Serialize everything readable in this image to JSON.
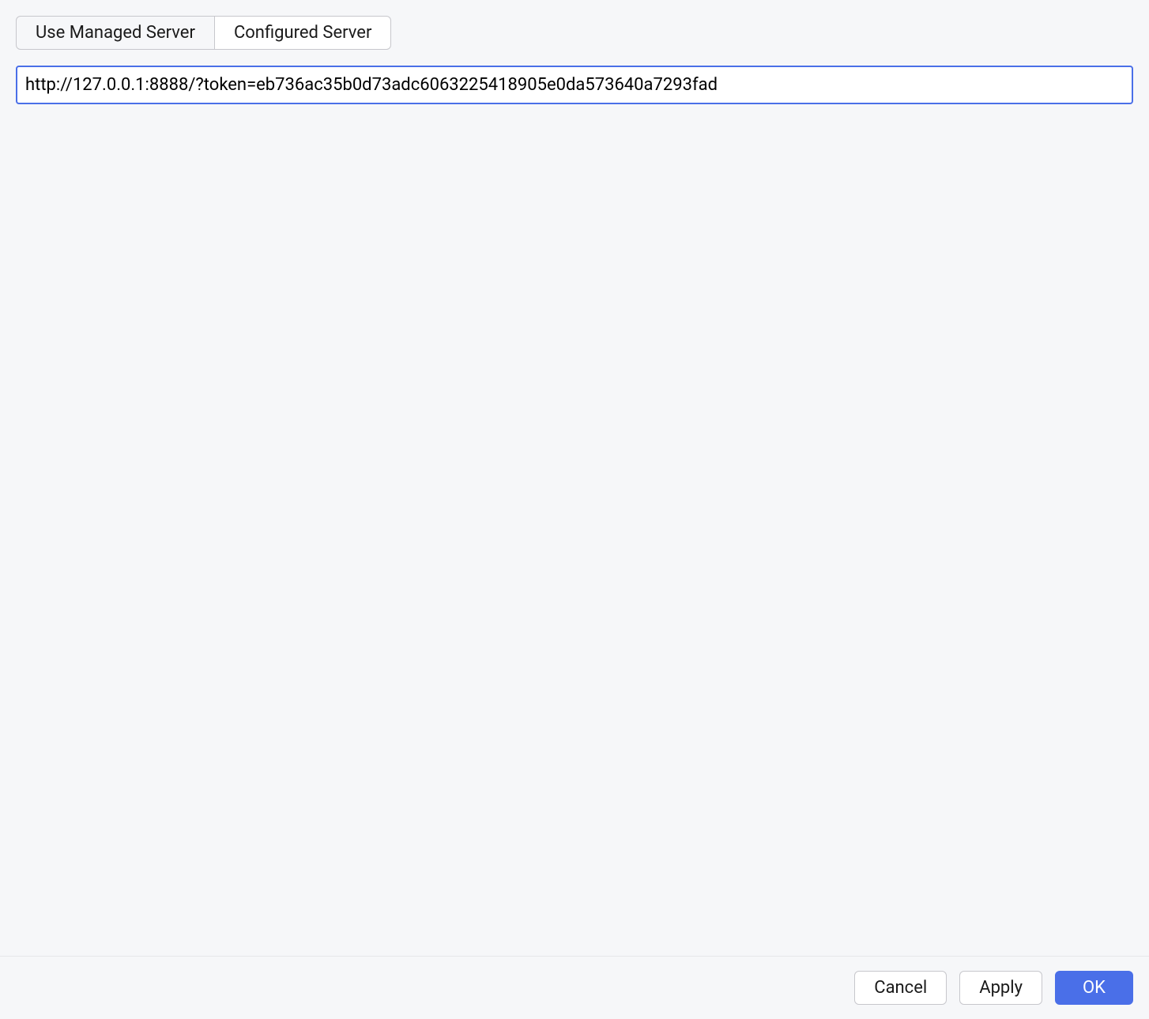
{
  "tabs": {
    "managed": "Use Managed Server",
    "configured": "Configured Server"
  },
  "url_value": "http://127.0.0.1:8888/?token=eb736ac35b0d73adc6063225418905e0da573640a7293fad",
  "buttons": {
    "cancel": "Cancel",
    "apply": "Apply",
    "ok": "OK"
  }
}
